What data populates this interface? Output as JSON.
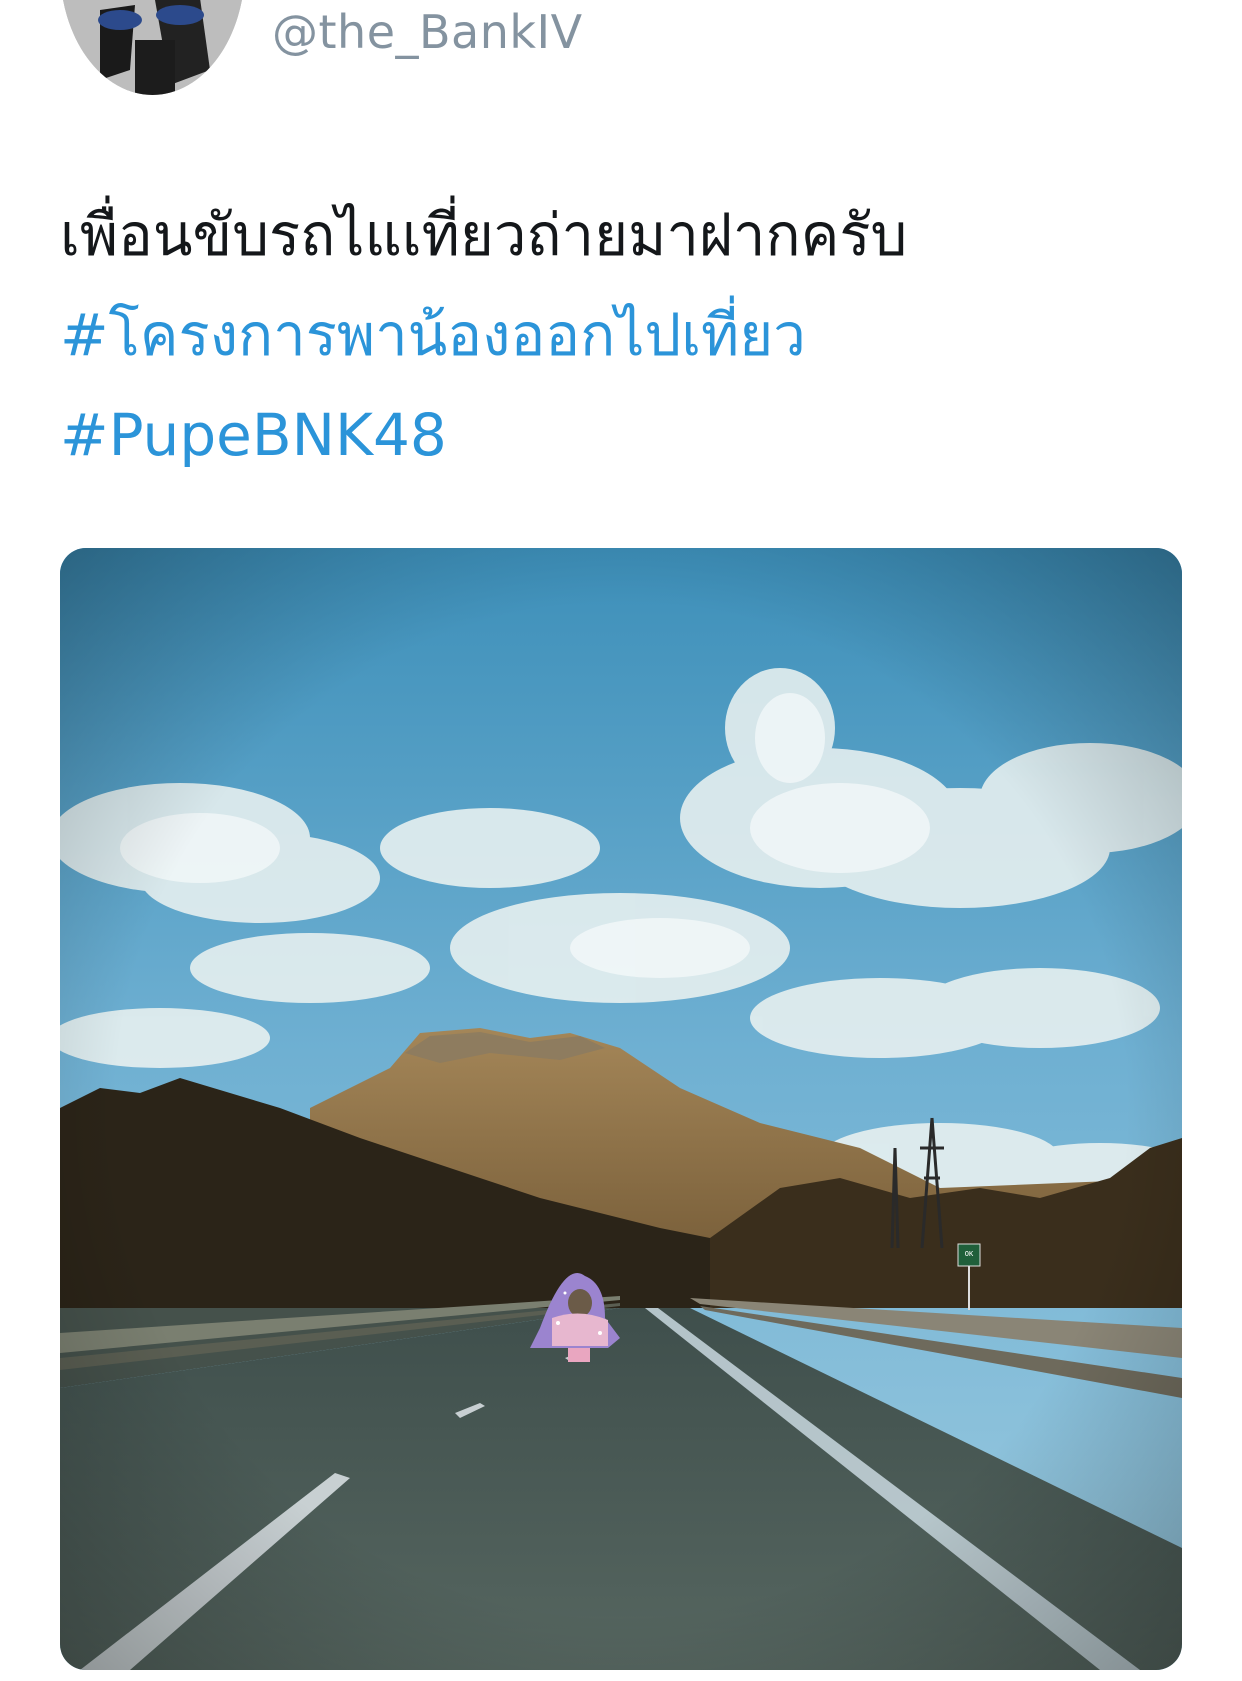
{
  "tweet": {
    "handle": "@the_BankIV",
    "text_line": "เพื่อนขับรถไแเที่ยวถ่ายมาฝากครับ",
    "hashtags": [
      "#โครงการพาน้องออกไปเที่ยว",
      "#PupeBNK48"
    ],
    "colors": {
      "text": "#14171a",
      "hashtag": "#2b94d9",
      "handle": "#8493a0"
    }
  },
  "media": {
    "sign_text": "OK\n "
  }
}
